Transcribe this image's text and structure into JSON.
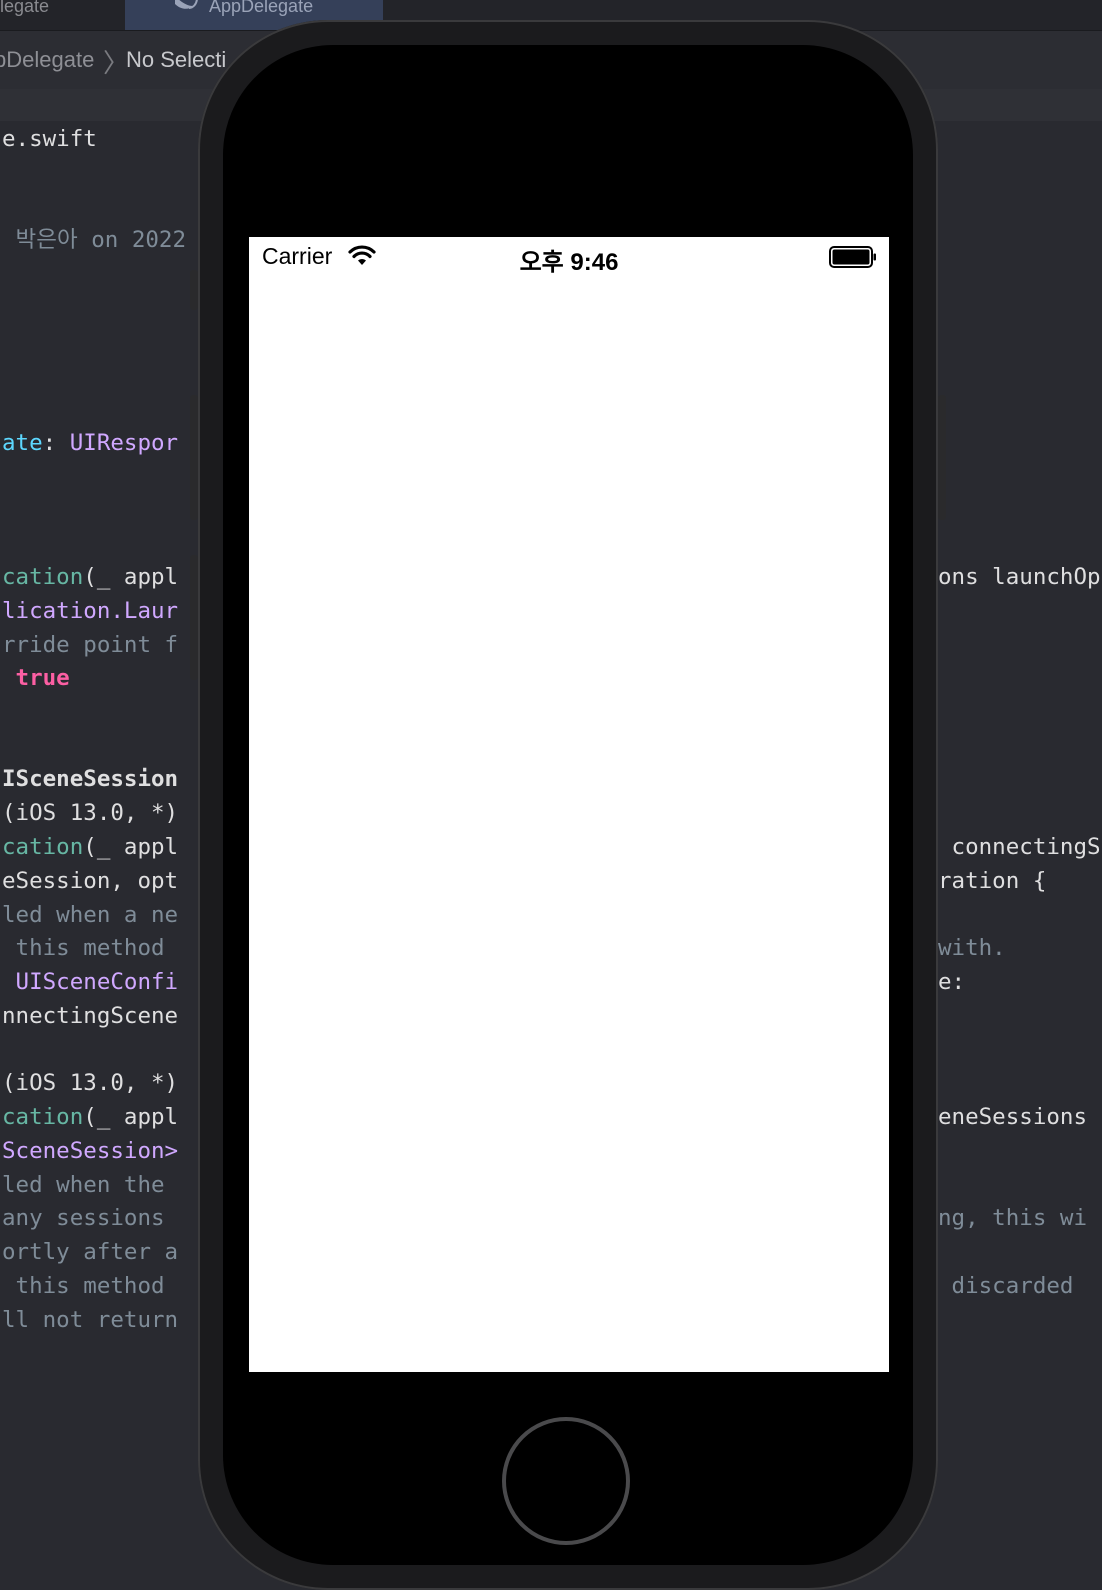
{
  "xcode": {
    "tabs": [
      {
        "label": "elegate"
      },
      {
        "label": "AppDelegate"
      }
    ],
    "jumpbar": {
      "segment1": "pDelegate",
      "segment2": "No Selecti"
    },
    "code_left": [
      {
        "text": "e.swift",
        "cls": "c-plain"
      },
      {
        "text": " 박은아 on 2022",
        "cls": "c-cmt"
      },
      {
        "text": "ate",
        "cls": "c-cyan",
        "rest": ": ",
        "rest2": "UIRespor"
      },
      {
        "text": "cation",
        "cls": "c-fn",
        "rest": "(_ appl"
      },
      {
        "text": "lication.Laur",
        "cls": "c-type"
      },
      {
        "text": "rride point f",
        "cls": "c-cmt"
      },
      {
        "text": " true",
        "cls": "c-kw"
      },
      {
        "text": "ISceneSession",
        "cls": "c-plain c-bold"
      },
      {
        "text": "(iOS 13.0, *)",
        "cls": "c-plain"
      },
      {
        "text": "cation",
        "cls": "c-fn",
        "rest": "(_ appl"
      },
      {
        "text": "eSession, opt",
        "cls": "c-plain"
      },
      {
        "text": "led when a ne",
        "cls": "c-cmt"
      },
      {
        "text": " this method ",
        "cls": "c-cmt"
      },
      {
        "text": " UISceneConfi",
        "cls": "c-type"
      },
      {
        "text": "nnectingScene",
        "cls": "c-plain"
      },
      {
        "text": "(iOS 13.0, *)",
        "cls": "c-plain"
      },
      {
        "text": "cation",
        "cls": "c-fn",
        "rest": "(_ appl"
      },
      {
        "text": "SceneSession>",
        "cls": "c-type"
      },
      {
        "text": "led when the ",
        "cls": "c-cmt"
      },
      {
        "text": "any sessions ",
        "cls": "c-cmt"
      },
      {
        "text": "ortly after a",
        "cls": "c-cmt"
      },
      {
        "text": " this method ",
        "cls": "c-cmt"
      },
      {
        "text": "ll not return",
        "cls": "c-cmt"
      }
    ],
    "code_right": [
      {
        "text": "ons launchOp",
        "cls": "c-plain"
      },
      {
        "text": " connectingS",
        "cls": "c-plain"
      },
      {
        "text": "ration {",
        "cls": "c-plain"
      },
      {
        "text": "with.",
        "cls": "c-cmt"
      },
      {
        "text": "e:",
        "cls": "c-plain"
      },
      {
        "text": "eneSessions",
        "cls": "c-plain"
      },
      {
        "text": "ng, this wi",
        "cls": "c-cmt"
      },
      {
        "text": " discarded",
        "cls": "c-cmt"
      }
    ]
  },
  "simulator": {
    "carrier": "Carrier",
    "time": "오후 9:46",
    "battery_level": 1.0
  }
}
